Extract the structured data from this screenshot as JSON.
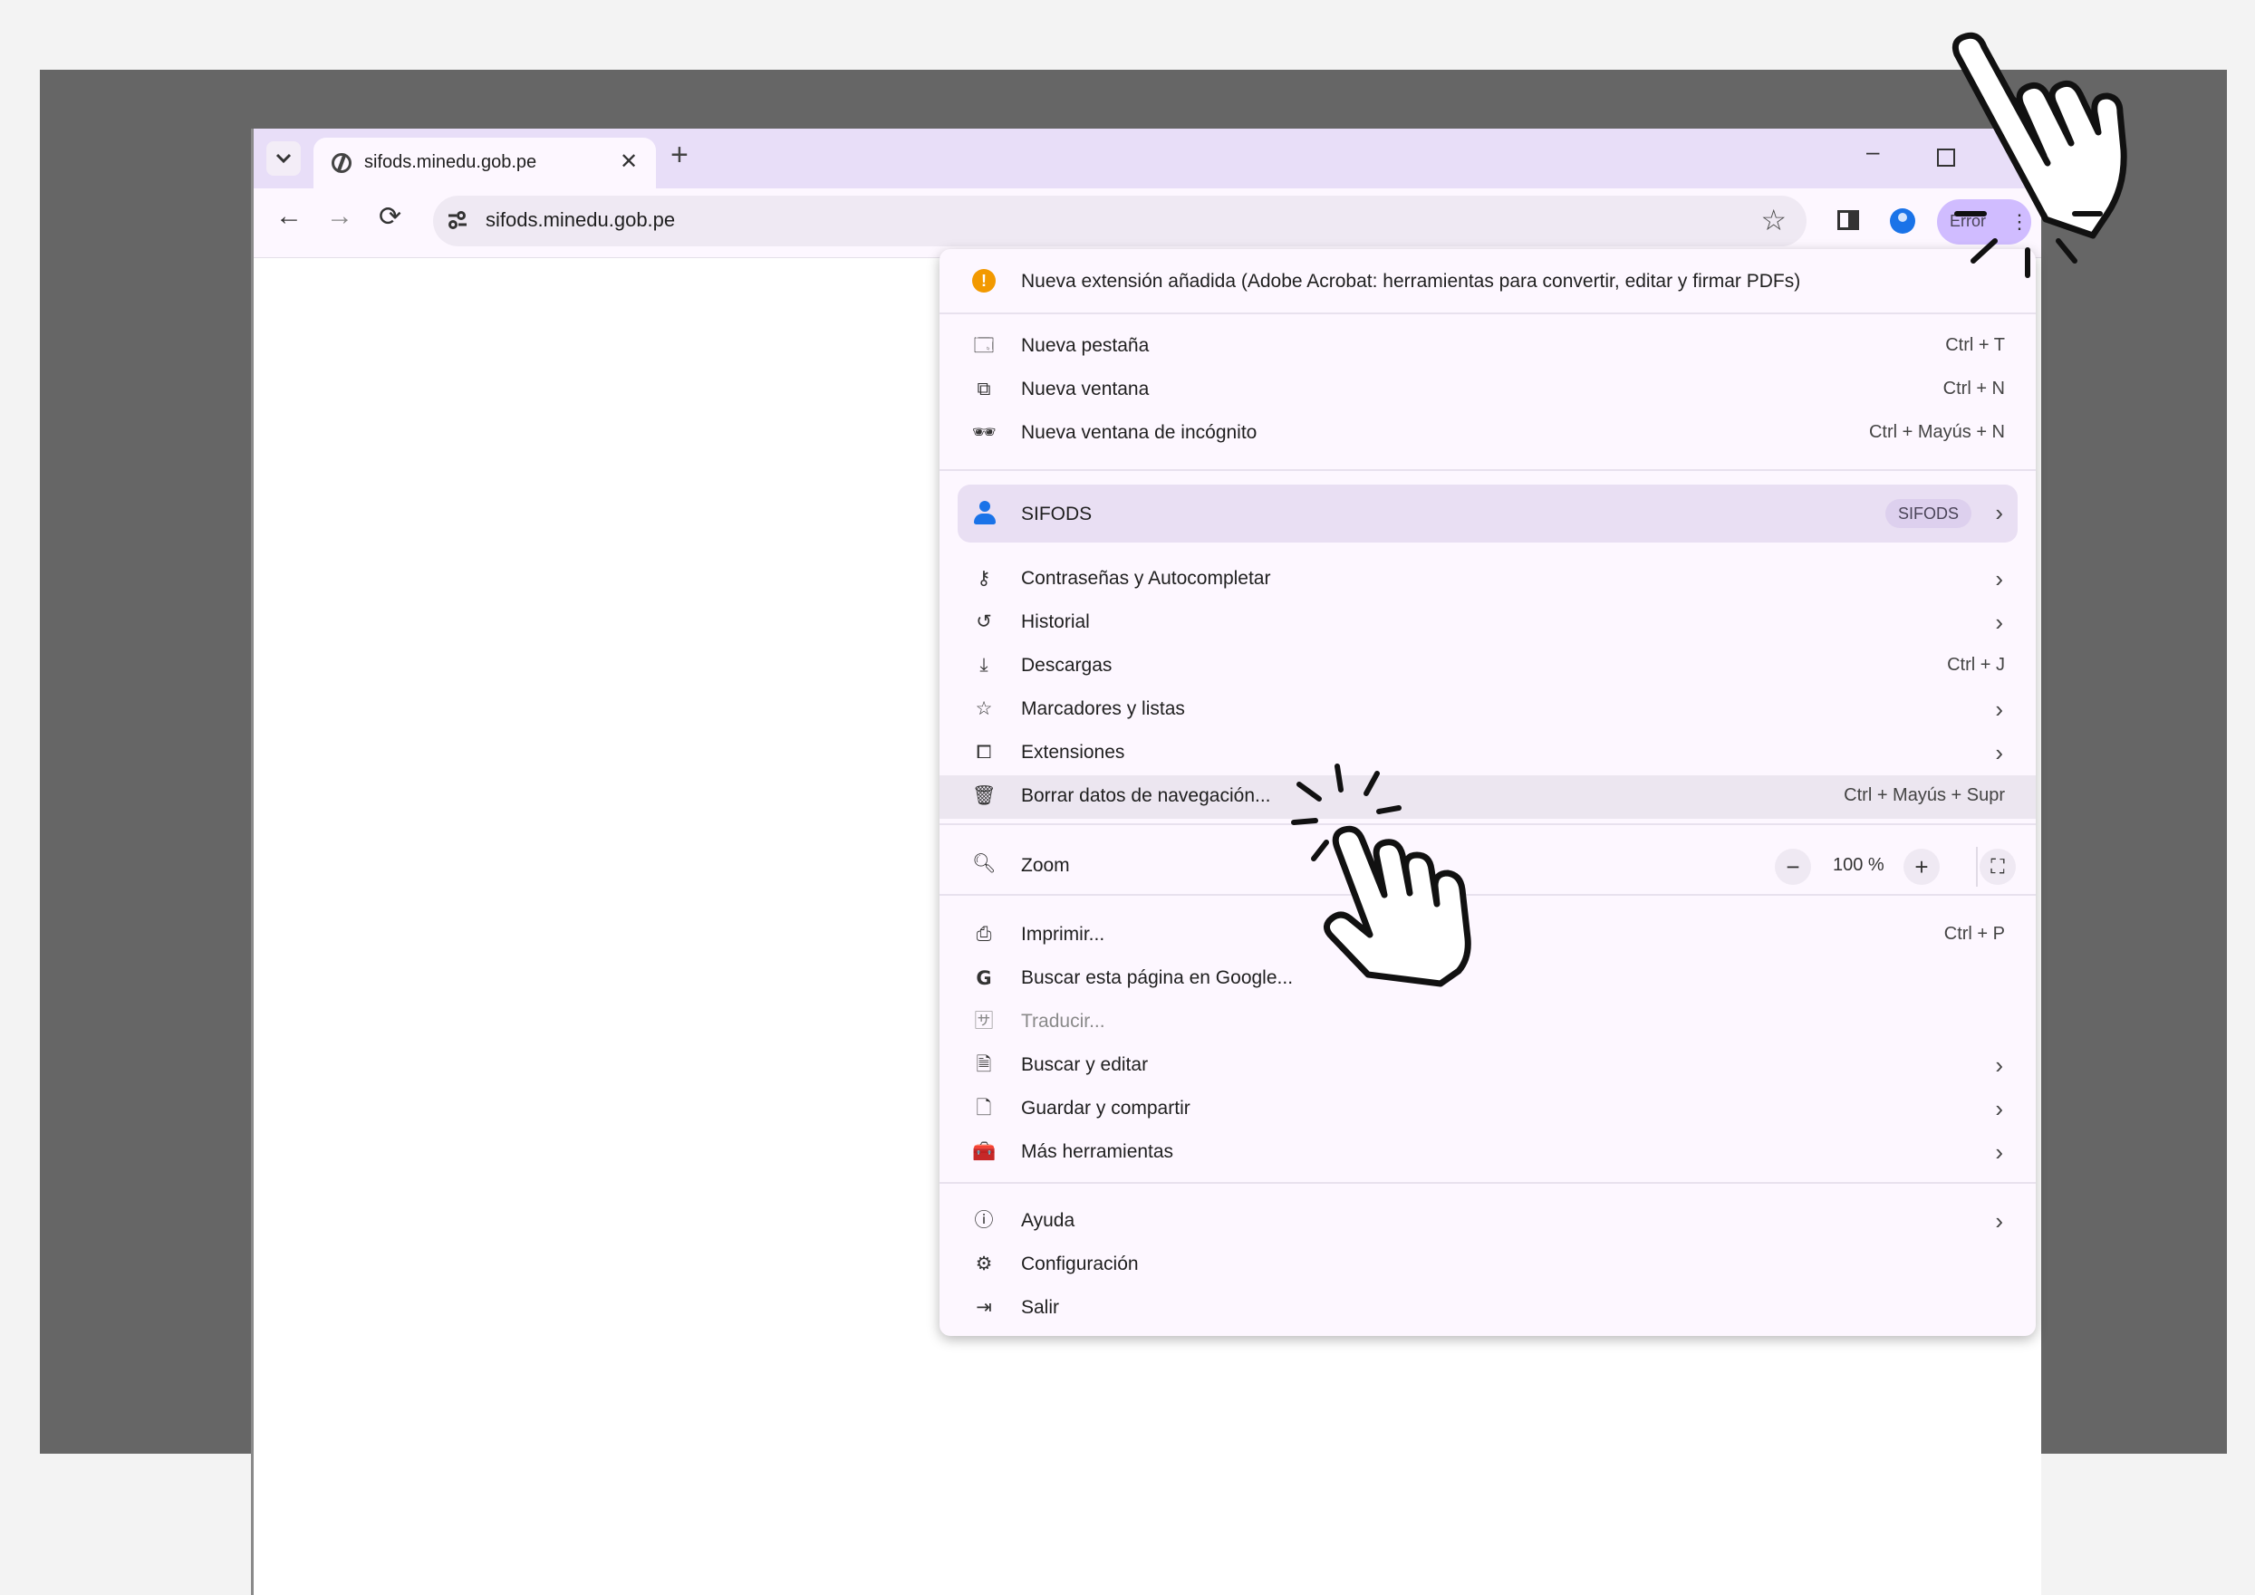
{
  "browser": {
    "tab_title": "sifods.minedu.gob.pe",
    "url": "sifods.minedu.gob.pe",
    "error_label": "Error"
  },
  "menu": {
    "alert": "Nueva extensión añadida (Adobe Acrobat: herramientas para convertir, editar y firmar PDFs)",
    "items": [
      {
        "label": "Nueva pestaña",
        "shortcut": "Ctrl + T",
        "icon": "new-tab-icon"
      },
      {
        "label": "Nueva ventana",
        "shortcut": "Ctrl + N",
        "icon": "new-window-icon"
      },
      {
        "label": "Nueva ventana de incógnito",
        "shortcut": "Ctrl + Mayús + N",
        "icon": "incognito-icon"
      },
      {
        "label": "Contraseñas y Autocompletar",
        "icon": "key-icon"
      },
      {
        "label": "Historial",
        "icon": "history-icon"
      },
      {
        "label": "Descargas",
        "shortcut": "Ctrl + J",
        "icon": "download-icon"
      },
      {
        "label": "Marcadores y listas",
        "icon": "star-icon"
      },
      {
        "label": "Extensiones",
        "icon": "puzzle-icon"
      },
      {
        "label": "Borrar datos de navegación...",
        "shortcut": "Ctrl + Mayús + Supr",
        "icon": "trash-icon"
      },
      {
        "label": "Imprimir...",
        "shortcut": "Ctrl + P",
        "icon": "printer-icon"
      },
      {
        "label": "Buscar esta página en Google...",
        "icon": "google-icon"
      },
      {
        "label": "Traducir...",
        "icon": "translate-icon"
      },
      {
        "label": "Buscar y editar",
        "icon": "find-edit-icon"
      },
      {
        "label": "Guardar y compartir",
        "icon": "save-share-icon"
      },
      {
        "label": "Más herramientas",
        "icon": "toolbox-icon"
      },
      {
        "label": "Ayuda",
        "icon": "help-icon"
      },
      {
        "label": "Configuración",
        "icon": "gear-icon"
      },
      {
        "label": "Salir",
        "icon": "exit-icon"
      }
    ],
    "profile": {
      "name": "SIFODS",
      "badge": "SIFODS"
    },
    "zoom": {
      "label": "Zoom",
      "value": "100 %",
      "minus": "−",
      "plus": "+"
    }
  },
  "colors": {
    "tabstrip": "#e8def8",
    "accent": "#d0bcff",
    "alert": "#f29900",
    "profile": "#1a73e8"
  }
}
